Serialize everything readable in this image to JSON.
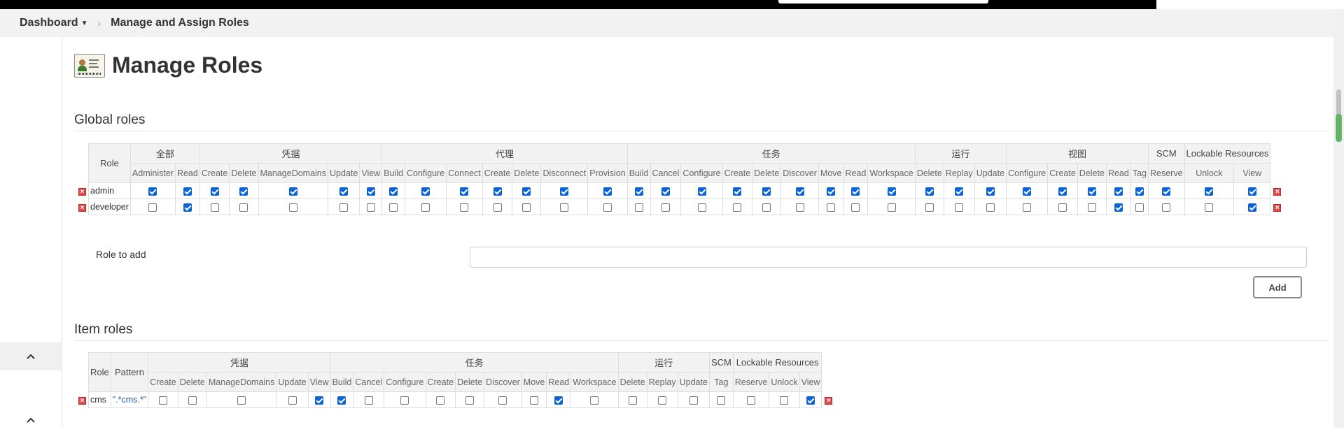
{
  "breadcrumb": {
    "dashboard": "Dashboard",
    "current": "Manage and Assign Roles"
  },
  "page_title": "Manage Roles",
  "global_roles": {
    "title": "Global roles",
    "role_header": "Role",
    "groups": [
      "全部",
      "凭据",
      "代理",
      "任务",
      "运行",
      "视图",
      "SCM",
      "Lockable Resources"
    ],
    "perms": [
      "Administer",
      "Read",
      "Create",
      "Delete",
      "ManageDomains",
      "Update",
      "View",
      "Build",
      "Configure",
      "Connect",
      "Create",
      "Delete",
      "Disconnect",
      "Provision",
      "Build",
      "Cancel",
      "Configure",
      "Create",
      "Delete",
      "Discover",
      "Move",
      "Read",
      "Workspace",
      "Delete",
      "Replay",
      "Update",
      "Configure",
      "Create",
      "Delete",
      "Read",
      "Tag",
      "Reserve",
      "Unlock",
      "View"
    ],
    "rows": [
      {
        "name": "admin",
        "checks": [
          true,
          true,
          true,
          true,
          true,
          true,
          true,
          true,
          true,
          true,
          true,
          true,
          true,
          true,
          true,
          true,
          true,
          true,
          true,
          true,
          true,
          true,
          true,
          true,
          true,
          true,
          true,
          true,
          true,
          true,
          true,
          true,
          true,
          true
        ]
      },
      {
        "name": "developer",
        "checks": [
          false,
          true,
          false,
          false,
          false,
          false,
          false,
          false,
          false,
          false,
          false,
          false,
          false,
          false,
          false,
          false,
          false,
          false,
          false,
          false,
          false,
          false,
          false,
          false,
          false,
          false,
          false,
          false,
          false,
          true,
          false,
          false,
          false,
          true
        ]
      }
    ]
  },
  "role_to_add": {
    "label": "Role to add",
    "value": "",
    "button": "Add"
  },
  "item_roles": {
    "title": "Item roles",
    "role_header": "Role",
    "pattern_header": "Pattern",
    "groups": [
      "凭据",
      "任务",
      "运行",
      "SCM",
      "Lockable Resources"
    ],
    "perms": [
      "Create",
      "Delete",
      "ManageDomains",
      "Update",
      "View",
      "Build",
      "Cancel",
      "Configure",
      "Create",
      "Delete",
      "Discover",
      "Move",
      "Read",
      "Workspace",
      "Delete",
      "Replay",
      "Update",
      "Tag",
      "Reserve",
      "Unlock",
      "View"
    ],
    "rows": [
      {
        "name": "cms",
        "pattern": "\".*cms.*\"",
        "checks": [
          false,
          false,
          false,
          false,
          true,
          true,
          false,
          false,
          false,
          false,
          false,
          false,
          true,
          false,
          false,
          false,
          false,
          false,
          false,
          false,
          true
        ]
      }
    ]
  },
  "icons": {
    "delete": "delete-icon",
    "collapse": "chevron-up-icon"
  }
}
